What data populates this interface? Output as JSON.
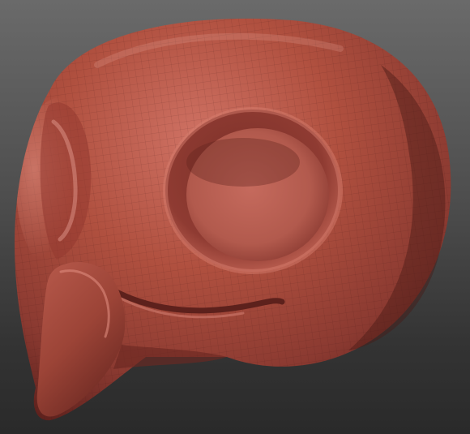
{
  "viewport": {
    "background_top": "#6a6a6a",
    "background_bottom": "#2a2a2a"
  },
  "model": {
    "subject": "sculpted-bird-head",
    "material_color": "#a8463d",
    "material_highlight": "#d77c70",
    "material_shadow": "#5a1f1b",
    "wireframe_visible": true
  }
}
